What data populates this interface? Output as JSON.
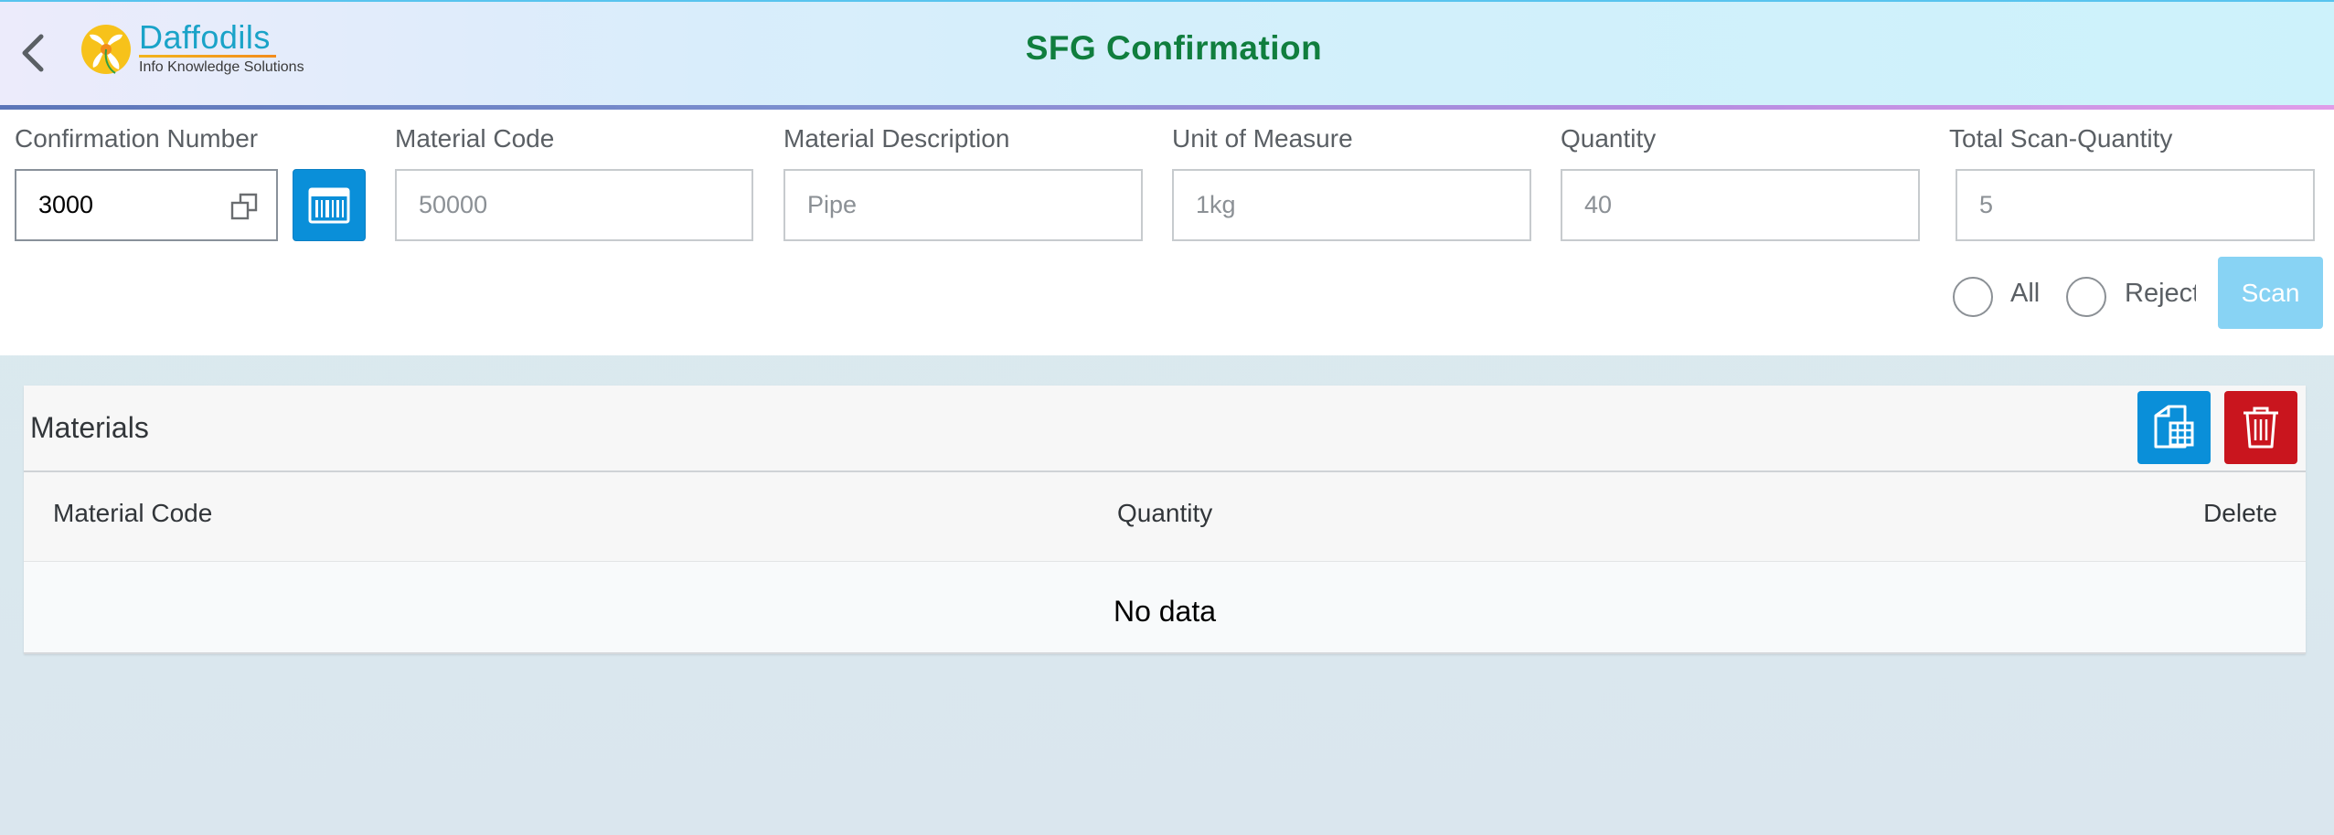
{
  "header": {
    "title": "SFG Confirmation",
    "logo": {
      "name": "Daffodils",
      "tagline": "Info Knowledge Solutions"
    }
  },
  "form": {
    "fields": {
      "confirmation_number": {
        "label": "Confirmation Number",
        "value": "3000"
      },
      "material_code": {
        "label": "Material Code",
        "placeholder": "50000"
      },
      "material_description": {
        "label": "Material Description",
        "placeholder": "Pipe"
      },
      "unit_of_measure": {
        "label": "Unit of Measure",
        "placeholder": "1kg"
      },
      "quantity": {
        "label": "Quantity",
        "placeholder": "40"
      },
      "total_scan_quantity": {
        "label": "Total Scan-Quantity",
        "placeholder": "5"
      }
    },
    "options": {
      "all_label": "All",
      "reject_label": "Reject",
      "all_selected": false,
      "reject_selected": false
    },
    "scan_label": "Scan"
  },
  "materials": {
    "title": "Materials",
    "columns": [
      "Material Code",
      "Quantity",
      "Delete"
    ],
    "rows": [],
    "empty_text": "No data"
  },
  "colors": {
    "title_green": "#107e3e",
    "accent_blue": "#0a8fd9",
    "danger_red": "#c9151e",
    "scan_disabled": "#88d3f4"
  }
}
